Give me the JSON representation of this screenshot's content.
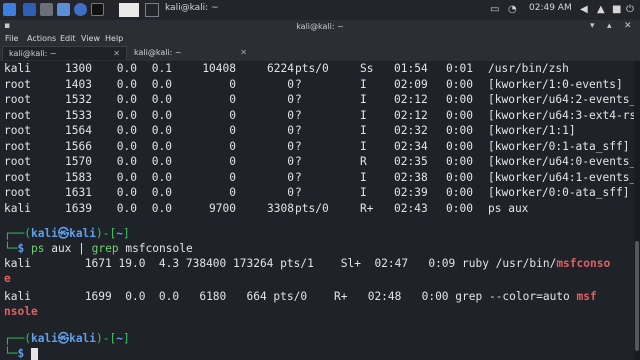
{
  "taskbar": {
    "task_label": "kali@kali: ~",
    "clock": "02:49 AM",
    "tray_icons": [
      "screen-icon",
      "notification-icon",
      "volume-icon",
      "lock-icon",
      "power-icon"
    ]
  },
  "window": {
    "title": "kali@kali: ~"
  },
  "menu": {
    "file": "File",
    "actions": "Actions",
    "edit": "Edit",
    "view": "View",
    "help": "Help"
  },
  "tabs": [
    {
      "label": "kali@kali: ~",
      "active": true
    },
    {
      "label": "kali@kali: ~",
      "active": false
    }
  ],
  "process_rows": [
    {
      "user": "kali",
      "pid": "1300",
      "cpu": "0.0",
      "mem": "0.1",
      "vsz": "10408",
      "rss": "6224",
      "tty": "pts/0",
      "stat": "Ss",
      "start": "01:54",
      "time": "0:01",
      "command": "/usr/bin/zsh"
    },
    {
      "user": "root",
      "pid": "1403",
      "cpu": "0.0",
      "mem": "0.0",
      "vsz": "0",
      "rss": "0",
      "tty": "?",
      "stat": "I",
      "start": "02:09",
      "time": "0:00",
      "command": "[kworker/1:0-events]"
    },
    {
      "user": "root",
      "pid": "1532",
      "cpu": "0.0",
      "mem": "0.0",
      "vsz": "0",
      "rss": "0",
      "tty": "?",
      "stat": "I",
      "start": "02:12",
      "time": "0:00",
      "command": "[kworker/u64:2-events_"
    },
    {
      "user": "root",
      "pid": "1533",
      "cpu": "0.0",
      "mem": "0.0",
      "vsz": "0",
      "rss": "0",
      "tty": "?",
      "stat": "I",
      "start": "02:12",
      "time": "0:00",
      "command": "[kworker/u64:3-ext4-rs"
    },
    {
      "user": "root",
      "pid": "1564",
      "cpu": "0.0",
      "mem": "0.0",
      "vsz": "0",
      "rss": "0",
      "tty": "?",
      "stat": "I",
      "start": "02:32",
      "time": "0:00",
      "command": "[kworker/1:1]"
    },
    {
      "user": "root",
      "pid": "1566",
      "cpu": "0.0",
      "mem": "0.0",
      "vsz": "0",
      "rss": "0",
      "tty": "?",
      "stat": "I",
      "start": "02:34",
      "time": "0:00",
      "command": "[kworker/0:1-ata_sff]"
    },
    {
      "user": "root",
      "pid": "1570",
      "cpu": "0.0",
      "mem": "0.0",
      "vsz": "0",
      "rss": "0",
      "tty": "?",
      "stat": "R",
      "start": "02:35",
      "time": "0:00",
      "command": "[kworker/u64:0-events_"
    },
    {
      "user": "root",
      "pid": "1583",
      "cpu": "0.0",
      "mem": "0.0",
      "vsz": "0",
      "rss": "0",
      "tty": "?",
      "stat": "I",
      "start": "02:38",
      "time": "0:00",
      "command": "[kworker/u64:1-events_"
    },
    {
      "user": "root",
      "pid": "1631",
      "cpu": "0.0",
      "mem": "0.0",
      "vsz": "0",
      "rss": "0",
      "tty": "?",
      "stat": "I",
      "start": "02:39",
      "time": "0:00",
      "command": "[kworker/0:0-ata_sff]"
    },
    {
      "user": "kali",
      "pid": "1639",
      "cpu": "0.0",
      "mem": "0.0",
      "vsz": "9700",
      "rss": "3308",
      "tty": "pts/0",
      "stat": "R+",
      "start": "02:43",
      "time": "0:00",
      "command": "ps aux"
    }
  ],
  "prompt": {
    "top_open": "┌──(",
    "user_host": "kali㉿kali",
    "top_close": ")-[",
    "dir": "~",
    "top_end": "]",
    "bottom": "└─",
    "dollar": "$"
  },
  "command1": {
    "cmd1": "ps",
    "arg1": " aux ",
    "pipe": "|",
    "cmd2": " grep",
    "arg2": " msfconsole"
  },
  "grep_rows": [
    {
      "prefix": "kali        1671 19.0  4.3 738400 173264 pts/1    Sl+  02:47   0:09 ruby /usr/bin/",
      "match1": "msfconso",
      "match2": "e"
    },
    {
      "prefix": "kali        1699  0.0  0.0   6180   664 pts/0    R+   02:48   0:00 grep --color=auto ",
      "match1": "msf",
      "match2": "nsole"
    }
  ]
}
